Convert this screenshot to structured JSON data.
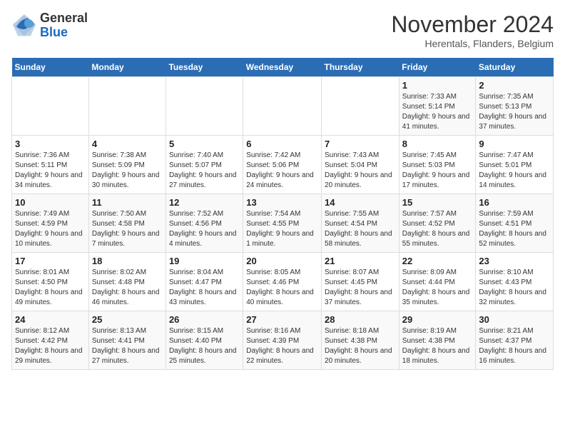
{
  "header": {
    "logo_general": "General",
    "logo_blue": "Blue",
    "month_title": "November 2024",
    "location": "Herentals, Flanders, Belgium"
  },
  "weekdays": [
    "Sunday",
    "Monday",
    "Tuesday",
    "Wednesday",
    "Thursday",
    "Friday",
    "Saturday"
  ],
  "weeks": [
    [
      {
        "day": "",
        "info": ""
      },
      {
        "day": "",
        "info": ""
      },
      {
        "day": "",
        "info": ""
      },
      {
        "day": "",
        "info": ""
      },
      {
        "day": "",
        "info": ""
      },
      {
        "day": "1",
        "info": "Sunrise: 7:33 AM\nSunset: 5:14 PM\nDaylight: 9 hours and 41 minutes."
      },
      {
        "day": "2",
        "info": "Sunrise: 7:35 AM\nSunset: 5:13 PM\nDaylight: 9 hours and 37 minutes."
      }
    ],
    [
      {
        "day": "3",
        "info": "Sunrise: 7:36 AM\nSunset: 5:11 PM\nDaylight: 9 hours and 34 minutes."
      },
      {
        "day": "4",
        "info": "Sunrise: 7:38 AM\nSunset: 5:09 PM\nDaylight: 9 hours and 30 minutes."
      },
      {
        "day": "5",
        "info": "Sunrise: 7:40 AM\nSunset: 5:07 PM\nDaylight: 9 hours and 27 minutes."
      },
      {
        "day": "6",
        "info": "Sunrise: 7:42 AM\nSunset: 5:06 PM\nDaylight: 9 hours and 24 minutes."
      },
      {
        "day": "7",
        "info": "Sunrise: 7:43 AM\nSunset: 5:04 PM\nDaylight: 9 hours and 20 minutes."
      },
      {
        "day": "8",
        "info": "Sunrise: 7:45 AM\nSunset: 5:03 PM\nDaylight: 9 hours and 17 minutes."
      },
      {
        "day": "9",
        "info": "Sunrise: 7:47 AM\nSunset: 5:01 PM\nDaylight: 9 hours and 14 minutes."
      }
    ],
    [
      {
        "day": "10",
        "info": "Sunrise: 7:49 AM\nSunset: 4:59 PM\nDaylight: 9 hours and 10 minutes."
      },
      {
        "day": "11",
        "info": "Sunrise: 7:50 AM\nSunset: 4:58 PM\nDaylight: 9 hours and 7 minutes."
      },
      {
        "day": "12",
        "info": "Sunrise: 7:52 AM\nSunset: 4:56 PM\nDaylight: 9 hours and 4 minutes."
      },
      {
        "day": "13",
        "info": "Sunrise: 7:54 AM\nSunset: 4:55 PM\nDaylight: 9 hours and 1 minute."
      },
      {
        "day": "14",
        "info": "Sunrise: 7:55 AM\nSunset: 4:54 PM\nDaylight: 8 hours and 58 minutes."
      },
      {
        "day": "15",
        "info": "Sunrise: 7:57 AM\nSunset: 4:52 PM\nDaylight: 8 hours and 55 minutes."
      },
      {
        "day": "16",
        "info": "Sunrise: 7:59 AM\nSunset: 4:51 PM\nDaylight: 8 hours and 52 minutes."
      }
    ],
    [
      {
        "day": "17",
        "info": "Sunrise: 8:01 AM\nSunset: 4:50 PM\nDaylight: 8 hours and 49 minutes."
      },
      {
        "day": "18",
        "info": "Sunrise: 8:02 AM\nSunset: 4:48 PM\nDaylight: 8 hours and 46 minutes."
      },
      {
        "day": "19",
        "info": "Sunrise: 8:04 AM\nSunset: 4:47 PM\nDaylight: 8 hours and 43 minutes."
      },
      {
        "day": "20",
        "info": "Sunrise: 8:05 AM\nSunset: 4:46 PM\nDaylight: 8 hours and 40 minutes."
      },
      {
        "day": "21",
        "info": "Sunrise: 8:07 AM\nSunset: 4:45 PM\nDaylight: 8 hours and 37 minutes."
      },
      {
        "day": "22",
        "info": "Sunrise: 8:09 AM\nSunset: 4:44 PM\nDaylight: 8 hours and 35 minutes."
      },
      {
        "day": "23",
        "info": "Sunrise: 8:10 AM\nSunset: 4:43 PM\nDaylight: 8 hours and 32 minutes."
      }
    ],
    [
      {
        "day": "24",
        "info": "Sunrise: 8:12 AM\nSunset: 4:42 PM\nDaylight: 8 hours and 29 minutes."
      },
      {
        "day": "25",
        "info": "Sunrise: 8:13 AM\nSunset: 4:41 PM\nDaylight: 8 hours and 27 minutes."
      },
      {
        "day": "26",
        "info": "Sunrise: 8:15 AM\nSunset: 4:40 PM\nDaylight: 8 hours and 25 minutes."
      },
      {
        "day": "27",
        "info": "Sunrise: 8:16 AM\nSunset: 4:39 PM\nDaylight: 8 hours and 22 minutes."
      },
      {
        "day": "28",
        "info": "Sunrise: 8:18 AM\nSunset: 4:38 PM\nDaylight: 8 hours and 20 minutes."
      },
      {
        "day": "29",
        "info": "Sunrise: 8:19 AM\nSunset: 4:38 PM\nDaylight: 8 hours and 18 minutes."
      },
      {
        "day": "30",
        "info": "Sunrise: 8:21 AM\nSunset: 4:37 PM\nDaylight: 8 hours and 16 minutes."
      }
    ]
  ]
}
